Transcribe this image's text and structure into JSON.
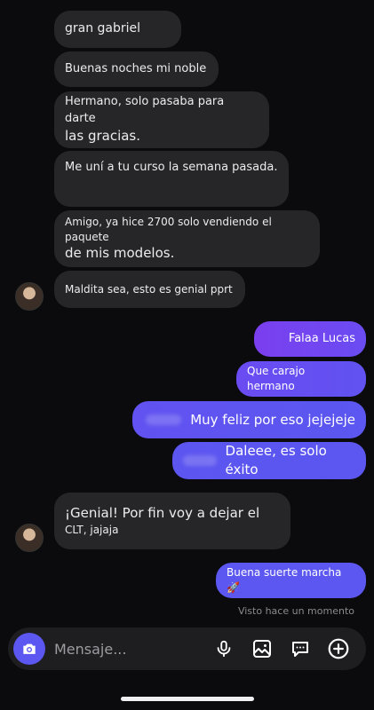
{
  "messages": {
    "m1": "gran gabriel",
    "m2": "Buenas noches mi noble",
    "m3a": "Hermano, solo pasaba para darte",
    "m3b": "las gracias.",
    "m4": "Me uní a tu curso la semana pasada.",
    "m5a": "Amigo, ya hice 2700 solo vendiendo el paquete",
    "m5b": "de mis modelos.",
    "m6": "Maldita sea, esto es genial pprt",
    "o1": "Falaa Lucas",
    "o2": "Que carajo hermano",
    "o3": "Muy feliz por eso jejejeje",
    "o4": "Daleee, es solo éxito",
    "m7a": "¡Genial! Por fin voy a dejar el",
    "m7b": "CLT, jajaja",
    "o5": "Buena suerte marcha 🚀"
  },
  "status": {
    "seen": "Visto hace un momento"
  },
  "composer": {
    "placeholder": "Mensaje..."
  },
  "colors": {
    "outgoing_gradient": [
      "#7b3ff0",
      "#5b57f0"
    ],
    "incoming": "#262629",
    "accent": "#5b57f0"
  },
  "icons": [
    "camera-icon",
    "microphone-icon",
    "image-icon",
    "sticker-icon",
    "plus-icon"
  ]
}
